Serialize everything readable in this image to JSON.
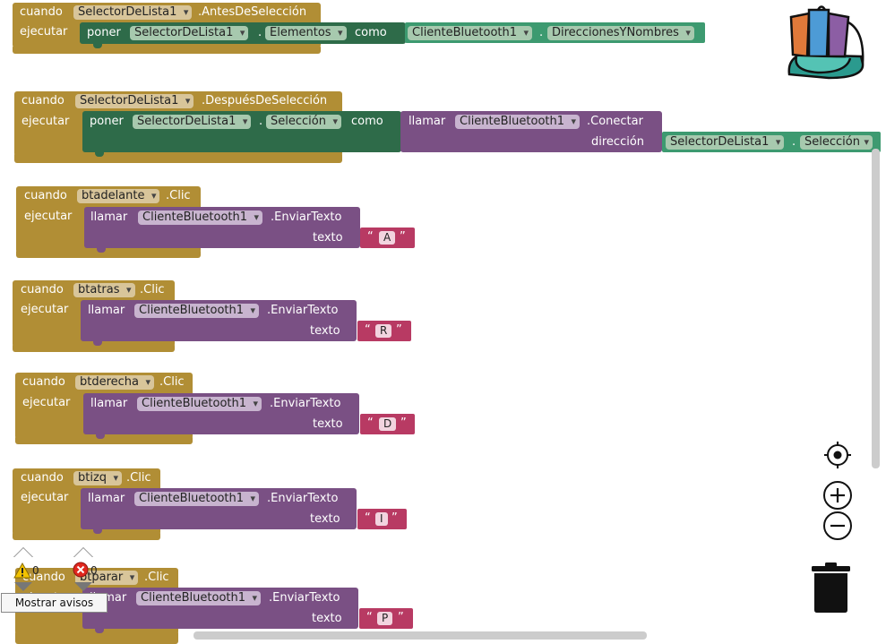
{
  "keywords": {
    "when": "cuando",
    "do": "ejecutar",
    "set": "poner",
    "to": "como",
    "call": "llamar",
    "text_param": "texto",
    "address_param": "dirección",
    "dot": "."
  },
  "block1": {
    "component": "SelectorDeLista1",
    "event": ".AntesDeSelección",
    "set_component": "SelectorDeLista1",
    "set_property": "Elementos",
    "get_component": "ClienteBluetooth1",
    "get_property": "DireccionesYNombres"
  },
  "block2": {
    "component": "SelectorDeLista1",
    "event": ".DespuésDeSelección",
    "set_component": "SelectorDeLista1",
    "set_property": "Selección",
    "call_component": "ClienteBluetooth1",
    "call_method": ".Conectar",
    "arg_component": "SelectorDeLista1",
    "arg_property": "Selección"
  },
  "clicks": [
    {
      "component": "btadelante",
      "event": ".Clic",
      "call_component": "ClienteBluetooth1",
      "method": ".EnviarTexto",
      "text": "A"
    },
    {
      "component": "btatras",
      "event": ".Clic",
      "call_component": "ClienteBluetooth1",
      "method": ".EnviarTexto",
      "text": "R"
    },
    {
      "component": "btderecha",
      "event": ".Clic",
      "call_component": "ClienteBluetooth1",
      "method": ".EnviarTexto",
      "text": "D"
    },
    {
      "component": "btizq",
      "event": ".Clic",
      "call_component": "ClienteBluetooth1",
      "method": ".EnviarTexto",
      "text": "I"
    },
    {
      "component": "btparar",
      "event": ".Clic",
      "call_component": "ClienteBluetooth1",
      "method": ".EnviarTexto",
      "text": "P"
    }
  ],
  "warnings": {
    "warning_count": "0",
    "error_count": "0",
    "show_warnings_label": "Mostrar avisos"
  },
  "icons": {
    "backpack": "backpack-icon",
    "recenter": "crosshair-icon",
    "zoom_in": "plus-circle-icon",
    "zoom_out": "minus-circle-icon",
    "trash": "trash-icon",
    "warning": "warning-triangle-icon",
    "error": "error-circle-icon"
  },
  "colors": {
    "event_block": "#b18e35",
    "set_block": "#2e6b49",
    "component_getter": "#3d9a70",
    "method_call": "#7a5084",
    "text_string": "#b83a63"
  }
}
